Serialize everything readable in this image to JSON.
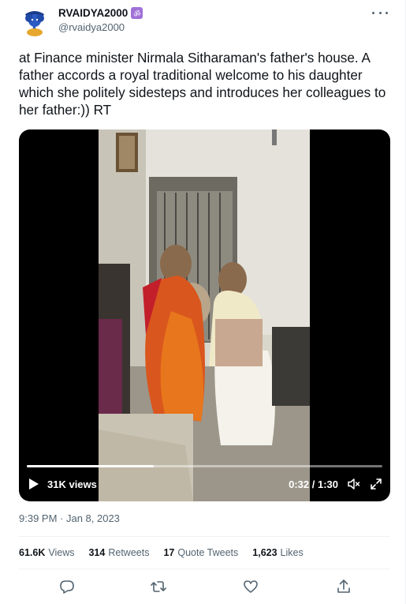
{
  "user": {
    "display_name": "RVAIDYA2000",
    "badge_glyph": "ॐ",
    "handle": "@rvaidya2000",
    "avatar_icon": "ganesha-avatar"
  },
  "tweet": {
    "text": "at Finance minister Nirmala Sitharaman's father's house. A father accords a royal traditional welcome to his daughter which she politely sidesteps and introduces her colleagues to her father:)) RT",
    "timestamp": "9:39 PM · Jan 8, 2023"
  },
  "video": {
    "views": "31K views",
    "time": "0:32 / 1:30",
    "progress": 0.356
  },
  "stats": [
    {
      "value": "61.6K",
      "label": "Views"
    },
    {
      "value": "314",
      "label": "Retweets"
    },
    {
      "value": "17",
      "label": "Quote Tweets"
    },
    {
      "value": "1,623",
      "label": "Likes"
    }
  ],
  "actions": [
    "reply-icon",
    "retweet-icon",
    "like-icon",
    "share-icon"
  ],
  "colors": {
    "text": "#0f1419",
    "secondary": "#536471",
    "badge": "#a070d8"
  }
}
